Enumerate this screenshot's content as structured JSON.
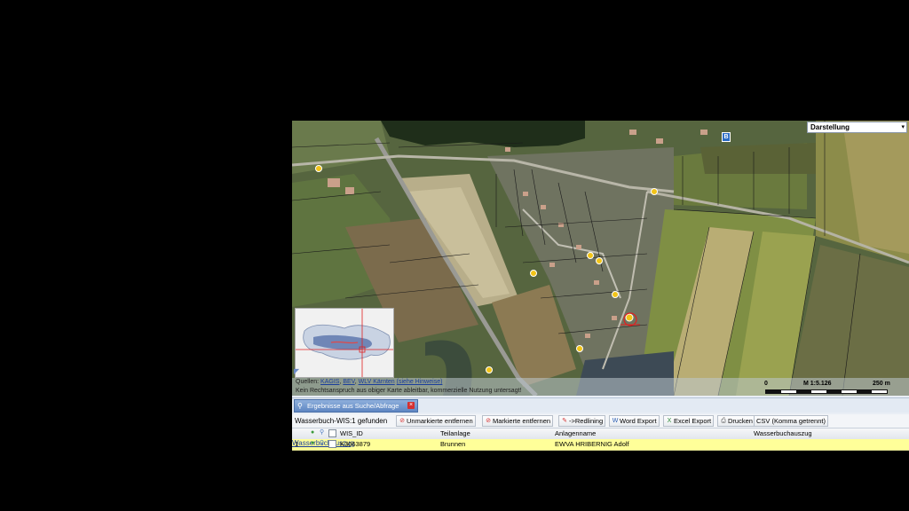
{
  "map": {
    "layer_select": {
      "value": "Darstellung",
      "arrow": "▾"
    },
    "poi_marker": "B",
    "credits": {
      "prefix": "Quellen: ",
      "links": [
        "KAGIS",
        "BEV",
        "WLV Kärnten",
        "(siehe Hinweise)"
      ],
      "separators": [
        ", ",
        ", ",
        " "
      ],
      "disclaimer": "Kein Rechtsanspruch aus obiger Karte ableitbar, kommerzielle Nutzung untersagt!"
    },
    "scale": {
      "zero": "0",
      "ratio": "M 1:5.126",
      "max": "250 m"
    }
  },
  "panel": {
    "tab_label": "Ergebnisse aus Suche/Abfrage",
    "tab_close": "×",
    "found_label": "Wasserbuch-WIS:1 gefunden",
    "buttons": [
      {
        "label": "Unmarkierte entfernen",
        "icon": "unmark-icon",
        "color": "#d43030"
      },
      {
        "label": "Markierte entfernen",
        "icon": "remove-marked-icon",
        "color": "#d43030"
      },
      {
        "label": "->Redlining",
        "icon": "redlining-icon",
        "color": "#d43030"
      },
      {
        "label": "Word Export",
        "icon": "word-icon",
        "color": "#2b5fb3"
      },
      {
        "label": "Excel Export",
        "icon": "excel-icon",
        "color": "#2e8b3a"
      },
      {
        "label": "Drucken",
        "icon": "print-icon",
        "color": "#555555"
      },
      {
        "label": "CSV (Komma getrennt)",
        "icon": "",
        "color": ""
      }
    ],
    "columns": [
      "WIS_ID",
      "Teilanlage",
      "Anlagenname",
      "Wasserbuchauszug"
    ],
    "rows": [
      {
        "num": "1",
        "wis_id": "K3063879",
        "teilanlage": "Brunnen",
        "anlagenname": "EWVA HRIBERNIG Adolf",
        "auszug": "Wasserbuchauszug"
      }
    ]
  },
  "colors": {
    "row_highlight": "#ffff99",
    "tab_blue": "#5e86c2",
    "link": "#1a3d9c"
  }
}
